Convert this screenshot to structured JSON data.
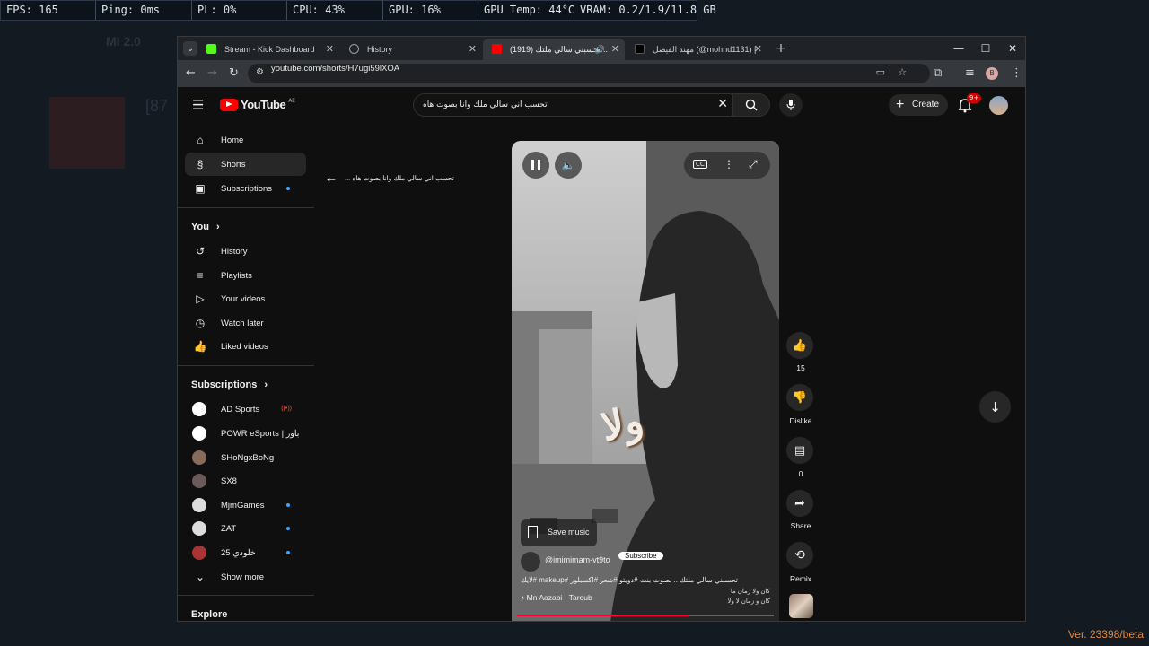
{
  "hud": {
    "fps": "FPS: 165",
    "ping": "Ping: 0ms",
    "pl": "PL: 0%",
    "cpu": "CPU: 43%",
    "gpu": "GPU: 16%",
    "gputemp": "GPU Temp: 44°C",
    "vram": "VRAM: 0.2/1.9/11.8 GB"
  },
  "version": "Ver. 23398/beta",
  "tabs": [
    {
      "label": "Stream - Kick Dashboard",
      "color": "#53fc18"
    },
    {
      "label": "History",
      "color": "#9aa0a6"
    },
    {
      "label": "(1919) تحسبني سالي ملتك ..",
      "color": "#ff0000"
    },
    {
      "label": "مهند الفيصل (@mohnd1131) |",
      "color": "#ffffff"
    }
  ],
  "address": {
    "url": "youtube.com/shorts/H7ugi59lXOA"
  },
  "yt": {
    "logo": "YouTube",
    "country": "AE",
    "search": "تحسب اني سالي ملك وانا بصوت هاه",
    "create": "Create",
    "notif": "9+"
  },
  "sidebar": {
    "main": [
      {
        "label": "Home",
        "icon": "home-icon"
      },
      {
        "label": "Shorts",
        "icon": "shorts-icon"
      },
      {
        "label": "Subscriptions",
        "icon": "subscriptions-icon"
      }
    ],
    "you_header": "You",
    "you": [
      {
        "label": "History",
        "icon": "history-icon"
      },
      {
        "label": "Playlists",
        "icon": "playlists-icon"
      },
      {
        "label": "Your videos",
        "icon": "your-videos-icon"
      },
      {
        "label": "Watch later",
        "icon": "watch-later-icon"
      },
      {
        "label": "Liked videos",
        "icon": "like-icon"
      }
    ],
    "subs_header": "Subscriptions",
    "subs": [
      {
        "label": "AD Sports",
        "color": "#ffffff"
      },
      {
        "label": "POWR eSports | باور",
        "color": "#ffffff"
      },
      {
        "label": "SHoNgxBoNg",
        "color": "#8a6a5a"
      },
      {
        "label": "SX8",
        "color": "#6a5a5a"
      },
      {
        "label": "MjmGames",
        "color": "#2a2a2a"
      },
      {
        "label": "ZAT",
        "color": "#dddddd"
      },
      {
        "label": "خلودي 25",
        "color": "#aa3333"
      }
    ],
    "show_more": "Show more",
    "explore": "Explore"
  },
  "short": {
    "back_title": "... تحسب اني سالي ملك وانا بصوت هاه",
    "overlay_text": "ولا",
    "save_music": "Save music",
    "channel": "@imimimam-vt9to",
    "subscribe": "Subscribe",
    "caption": "تحسبني سالي ملتك .. بصوت بنت #دويتو #شعر #اكسبلور #makeup #لايك",
    "lyric1": "كان ولا زمان ما",
    "lyric2": "كان و زمان لا ولا",
    "music": "Mn Aazabi · Taroub",
    "likes": "15",
    "dislike": "Dislike",
    "comments": "0",
    "share": "Share",
    "remix": "Remix",
    "progress": 0.67
  }
}
